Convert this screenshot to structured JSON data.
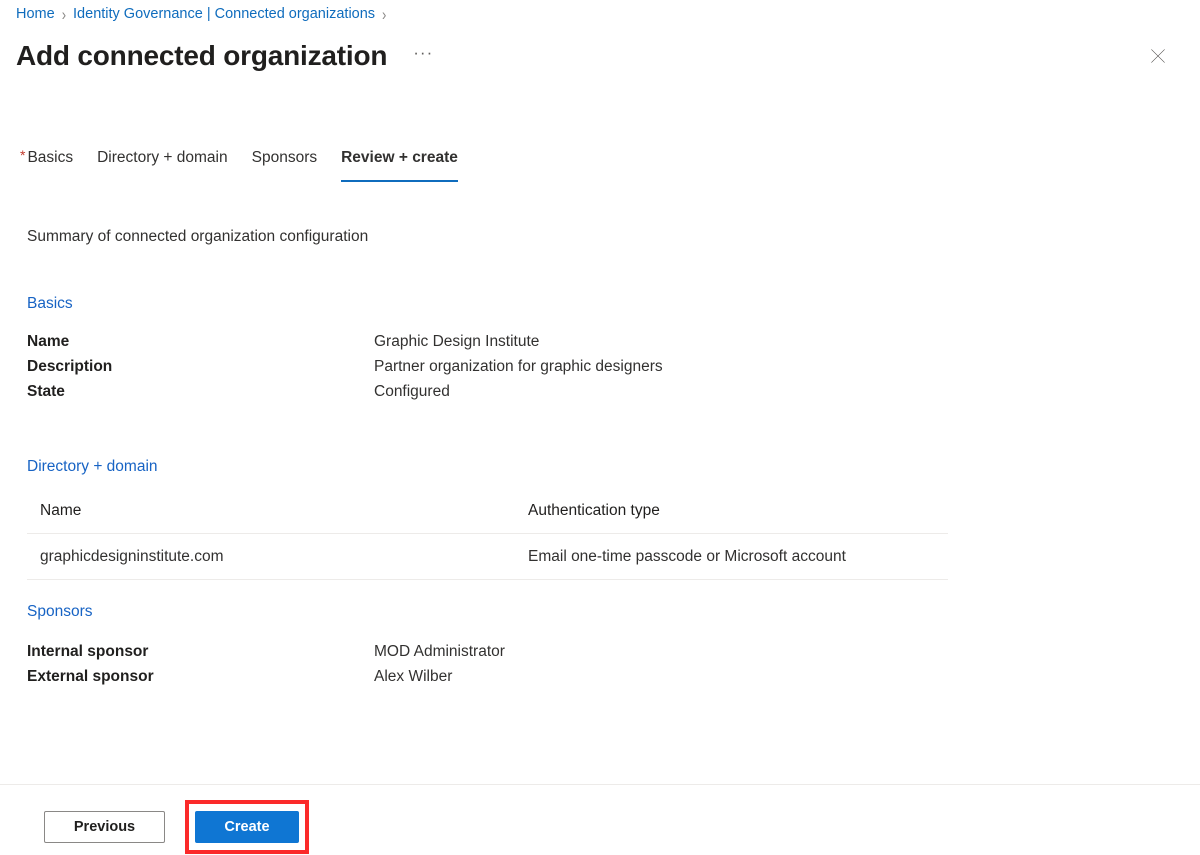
{
  "breadcrumb": {
    "separator": "›",
    "items": [
      {
        "label": "Home"
      },
      {
        "label": "Identity Governance | Connected organizations"
      }
    ]
  },
  "header": {
    "title": "Add connected organization",
    "more_label": "···",
    "close_label": "close-icon"
  },
  "tabs": [
    {
      "label": "Basics",
      "required": true,
      "selected": false
    },
    {
      "label": "Directory + domain",
      "required": false,
      "selected": false
    },
    {
      "label": "Sponsors",
      "required": false,
      "selected": false
    },
    {
      "label": "Review + create",
      "required": false,
      "selected": true
    }
  ],
  "main": {
    "summary_line": "Summary of connected organization configuration",
    "basics": {
      "heading": "Basics",
      "rows": [
        {
          "key": "Name",
          "value": "Graphic Design Institute"
        },
        {
          "key": "Description",
          "value": "Partner organization for graphic designers"
        },
        {
          "key": "State",
          "value": "Configured"
        }
      ]
    },
    "directory_domain": {
      "heading": "Directory + domain",
      "columns": [
        "Name",
        "Authentication type"
      ],
      "rows": [
        [
          "graphicdesigninstitute.com",
          "Email one-time passcode or Microsoft account"
        ]
      ]
    },
    "sponsors": {
      "heading": "Sponsors",
      "rows": [
        {
          "key": "Internal sponsor",
          "value": "MOD Administrator"
        },
        {
          "key": "External sponsor",
          "value": "Alex Wilber"
        }
      ]
    }
  },
  "footer": {
    "previous_label": "Previous",
    "create_label": "Create"
  },
  "colors": {
    "link": "#0f6cbd",
    "section_heading": "#1763c4",
    "primary_button": "#0f76d3",
    "highlight_box": "#fb2a2a",
    "required_star": "#c0392b"
  }
}
